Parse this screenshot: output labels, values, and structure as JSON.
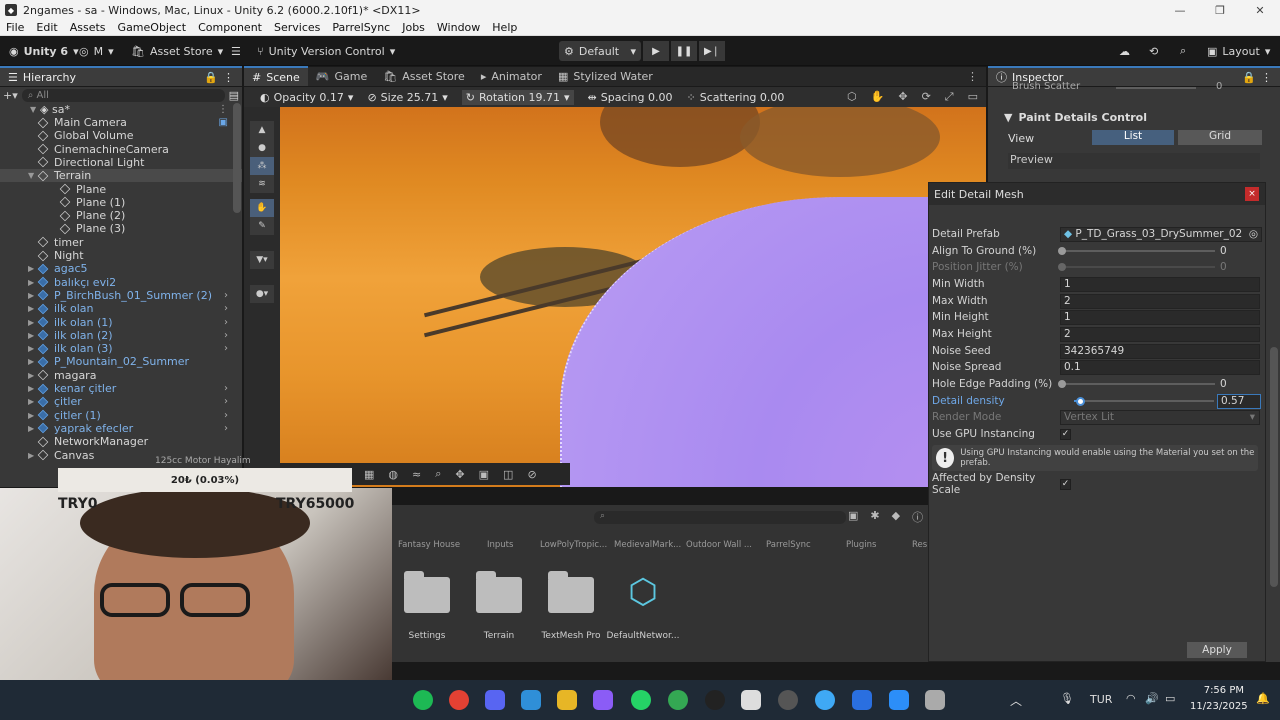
{
  "window": {
    "title": "2ngames - sa - Windows, Mac, Linux - Unity 6.2 (6000.2.10f1)* <DX11>"
  },
  "menu": [
    "File",
    "Edit",
    "Assets",
    "GameObject",
    "Component",
    "Services",
    "ParrelSync",
    "Jobs",
    "Window",
    "Help"
  ],
  "toolbar": {
    "unity_label": "Unity 6",
    "account_label": "M",
    "asset_store": "Asset Store",
    "version_control": "Unity Version Control",
    "layout_preset": "Default",
    "layout_label": "Layout"
  },
  "hierarchy": {
    "tab": "Hierarchy",
    "search_placeholder": "All",
    "scene_name": "sa*",
    "items": [
      {
        "label": "Main Camera",
        "color": "white",
        "depth": 1
      },
      {
        "label": "Global Volume",
        "color": "white",
        "depth": 1
      },
      {
        "label": "CinemachineCamera",
        "color": "white",
        "depth": 1
      },
      {
        "label": "Directional Light",
        "color": "white",
        "depth": 1
      },
      {
        "label": "Terrain",
        "color": "white",
        "depth": 1
      },
      {
        "label": "Plane",
        "color": "white",
        "depth": 2
      },
      {
        "label": "Plane (1)",
        "color": "white",
        "depth": 2
      },
      {
        "label": "Plane (2)",
        "color": "white",
        "depth": 2
      },
      {
        "label": "Plane (3)",
        "color": "white",
        "depth": 2
      },
      {
        "label": "timer",
        "color": "white",
        "depth": 1
      },
      {
        "label": "Night",
        "color": "white",
        "depth": 1
      },
      {
        "label": "agac5",
        "color": "blue",
        "depth": 1
      },
      {
        "label": "balıkçı evi2",
        "color": "blue",
        "depth": 1
      },
      {
        "label": "P_BirchBush_01_Summer (2)",
        "color": "blue",
        "depth": 1
      },
      {
        "label": "ilk olan",
        "color": "blue",
        "depth": 1
      },
      {
        "label": "ilk olan (1)",
        "color": "blue",
        "depth": 1
      },
      {
        "label": "ilk olan (2)",
        "color": "blue",
        "depth": 1
      },
      {
        "label": "ilk olan (3)",
        "color": "blue",
        "depth": 1
      },
      {
        "label": "P_Mountain_02_Summer",
        "color": "blue",
        "depth": 1
      },
      {
        "label": "magara",
        "color": "white",
        "depth": 1
      },
      {
        "label": "kenar çitler",
        "color": "blue",
        "depth": 1
      },
      {
        "label": "çitler",
        "color": "blue",
        "depth": 1
      },
      {
        "label": "çitler (1)",
        "color": "blue",
        "depth": 1
      },
      {
        "label": "yaprak efecler",
        "color": "blue",
        "depth": 1
      },
      {
        "label": "NetworkManager",
        "color": "white",
        "depth": 1
      },
      {
        "label": "Canvas",
        "color": "white",
        "depth": 1
      }
    ]
  },
  "scene": {
    "tabs": [
      "Scene",
      "Game",
      "Asset Store",
      "Animator",
      "Stylized Water"
    ],
    "opacity": "Opacity 0.17",
    "size": "Size 25.71",
    "rotation": "Rotation 19.71",
    "spacing": "Spacing 0.00",
    "scattering": "Scattering 0.00"
  },
  "inspector": {
    "tab": "Inspector",
    "brush_scatter": "Brush Scatter",
    "brush_scatter_value": "0",
    "section": "Paint Details Control",
    "view_label": "View",
    "view_list": "List",
    "view_grid": "Grid",
    "preview_label": "Preview"
  },
  "dialog": {
    "title": "Edit Detail Mesh",
    "rows": {
      "detail_prefab_label": "Detail Prefab",
      "detail_prefab_value": "P_TD_Grass_03_DrySummer_02",
      "align_label": "Align To Ground (%)",
      "align_value": "0",
      "jitter_label": "Position Jitter (%)",
      "jitter_value": "0",
      "min_width_label": "Min Width",
      "min_width_value": "1",
      "max_width_label": "Max Width",
      "max_width_value": "2",
      "min_height_label": "Min Height",
      "min_height_value": "1",
      "max_height_label": "Max Height",
      "max_height_value": "2",
      "noise_seed_label": "Noise Seed",
      "noise_seed_value": "342365749",
      "noise_spread_label": "Noise Spread",
      "noise_spread_value": "0.1",
      "hole_edge_label": "Hole Edge Padding (%)",
      "hole_edge_value": "0",
      "density_label": "Detail density",
      "density_value": "0.57",
      "render_mode_label": "Render Mode",
      "render_mode_value": "Vertex Lit",
      "gpu_label": "Use GPU Instancing",
      "gpu_note": "Using GPU Instancing would enable using the Material you set on the prefab.",
      "affected_label": "Affected by Density Scale",
      "apply": "Apply"
    }
  },
  "project": {
    "top_labels": [
      "Fantasy House",
      "Inputs",
      "LowPolyTropic...",
      "MedievalMark...",
      "Outdoor Wall ...",
      "ParrelSync",
      "Plugins",
      "Res"
    ],
    "items": [
      "Settings",
      "Terrain",
      "TextMesh Pro",
      "DefaultNetwor..."
    ]
  },
  "stream_overlay": {
    "motor_label": "125cc Motor Hayalim",
    "progress_text": "20₺ (0.03%)",
    "goal_start": "TRY0",
    "goal_end": "TRY65000"
  },
  "taskbar": {
    "language": "TUR",
    "time": "7:56 PM",
    "date": "11/23/2025"
  }
}
